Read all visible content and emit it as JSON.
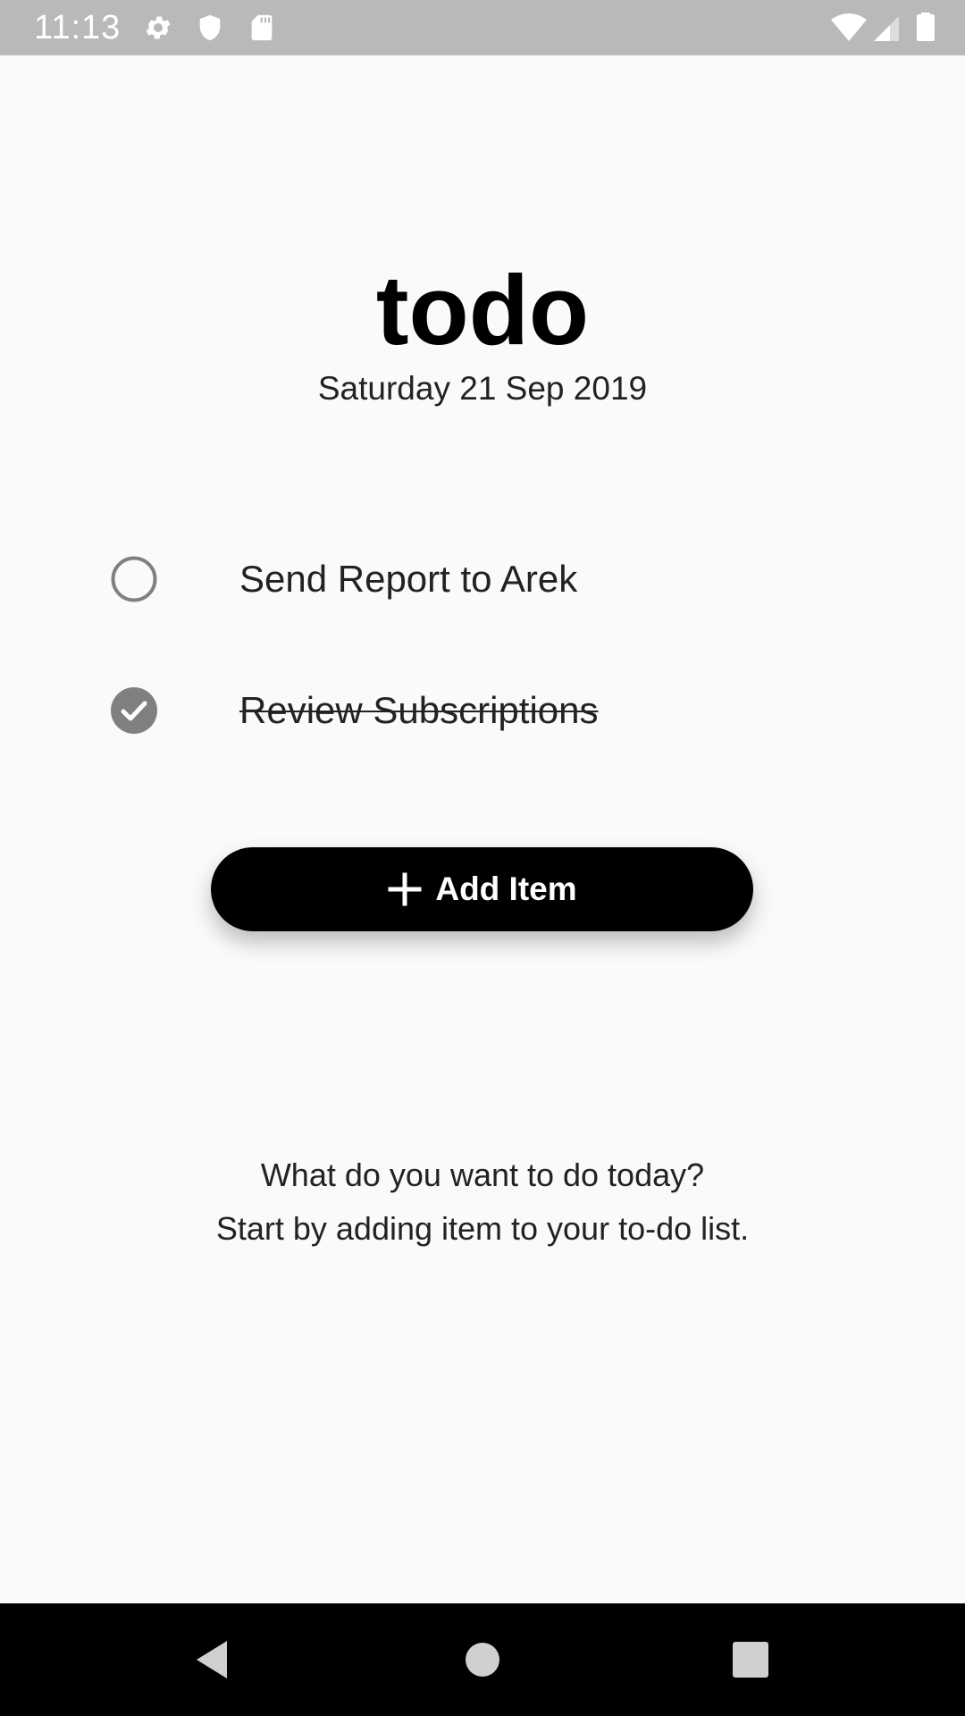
{
  "status_bar": {
    "time": "11:13",
    "left_icons": [
      "gear-icon",
      "shield-icon",
      "sd-card-icon"
    ],
    "right_icons": [
      "wifi-icon",
      "signal-icon",
      "battery-icon"
    ],
    "background": "#b9b9b9"
  },
  "header": {
    "title": "todo",
    "date": "Saturday 21 Sep 2019"
  },
  "todos": [
    {
      "label": "Send Report to Arek",
      "done": false
    },
    {
      "label": "Review Subscriptions",
      "done": true
    }
  ],
  "add_button": {
    "label": "Add Item",
    "icon": "plus-icon"
  },
  "prompt": {
    "line1": "What do you want to do today?",
    "line2": "Start by adding item to your to-do list."
  },
  "nav_bar": {
    "buttons": [
      "back-icon",
      "home-icon",
      "recents-icon"
    ]
  },
  "colors": {
    "accent": "#000000",
    "check_gray": "#808080",
    "background": "#fafafa"
  }
}
